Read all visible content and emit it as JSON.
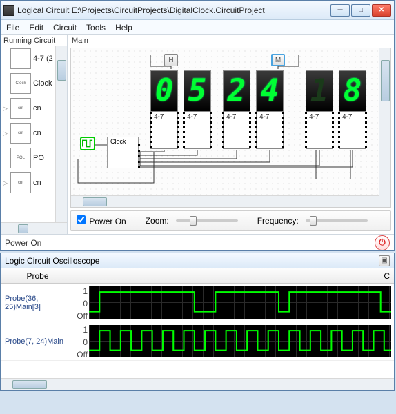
{
  "window": {
    "title": "Logical Circuit E:\\Projects\\CircuitProjects\\DigitalClock.CircuitProject"
  },
  "menu": {
    "file": "File",
    "edit": "Edit",
    "circuit": "Circuit",
    "tools": "Tools",
    "help": "Help"
  },
  "sidebar": {
    "title": "Running Circuit",
    "items": [
      {
        "thumb": "",
        "label": "4-7 (2"
      },
      {
        "thumb": "Clock",
        "label": "Clock"
      },
      {
        "thumb": "cnt",
        "label": "cn"
      },
      {
        "thumb": "cnt",
        "label": "cn"
      },
      {
        "thumb": "POL",
        "label": "PO"
      },
      {
        "thumb": "cnt",
        "label": "cn"
      }
    ]
  },
  "main": {
    "title": "Main",
    "chips": {
      "h": "H",
      "m": "M"
    },
    "clock_label": "Clock",
    "module_label": "4-7",
    "digits": [
      "0",
      "5",
      "2",
      "4",
      "1",
      "8"
    ],
    "dim": [
      false,
      false,
      false,
      false,
      true,
      false
    ]
  },
  "controls": {
    "power_on_label": "Power On",
    "power_on_checked": true,
    "zoom_label": "Zoom:",
    "freq_label": "Frequency:",
    "zoom_pos": 20,
    "freq_pos": 6
  },
  "status": {
    "text": "Power On"
  },
  "oscilloscope": {
    "title": "Logic Circuit Oscilloscope",
    "col_probe": "Probe",
    "col_right": "C",
    "y_labels": {
      "one": "1",
      "zero": "0",
      "off": "Off"
    },
    "probes": [
      {
        "name": "Probe(36, 25)Main[3]"
      },
      {
        "name": "Probe(7, 24)Main"
      }
    ]
  },
  "chart_data": [
    {
      "type": "line",
      "title": "Probe(36, 25)Main[3]",
      "ylabel": "",
      "ylim": [
        0,
        1
      ],
      "x": [
        0,
        1,
        1,
        10,
        10,
        12,
        12,
        18,
        18,
        19,
        19,
        28,
        28,
        30
      ],
      "values": [
        0,
        0,
        1,
        1,
        0,
        0,
        1,
        1,
        0,
        0,
        1,
        1,
        0,
        0
      ]
    },
    {
      "type": "line",
      "title": "Probe(7, 24)Main",
      "ylabel": "",
      "ylim": [
        0,
        1
      ],
      "x": [
        0,
        0.5,
        0.5,
        1,
        1,
        1.5,
        1.5,
        2,
        2,
        2.5,
        2.5,
        3,
        3,
        3.5,
        3.5,
        4,
        4,
        4.5,
        4.5,
        5,
        5,
        5.5,
        5.5,
        6,
        6,
        6.5,
        6.5,
        7,
        7,
        7.5,
        7.5,
        8,
        8,
        8.5,
        8.5,
        9,
        9,
        9.5,
        9.5,
        10,
        10,
        10.5,
        10.5,
        11,
        11,
        11.5,
        11.5,
        12,
        12,
        12.5,
        12.5,
        13,
        13,
        13.5,
        13.5,
        14,
        14,
        14.5,
        14.5,
        15
      ],
      "values": [
        0,
        0,
        1,
        1,
        0,
        0,
        1,
        1,
        0,
        0,
        1,
        1,
        0,
        0,
        1,
        1,
        0,
        0,
        1,
        1,
        0,
        0,
        1,
        1,
        0,
        0,
        1,
        1,
        0,
        0,
        1,
        1,
        0,
        0,
        1,
        1,
        0,
        0,
        1,
        1,
        0,
        0,
        1,
        1,
        0,
        0,
        1,
        1,
        0,
        0,
        1,
        1,
        0,
        0,
        1,
        1,
        0,
        0,
        1,
        1
      ]
    }
  ]
}
